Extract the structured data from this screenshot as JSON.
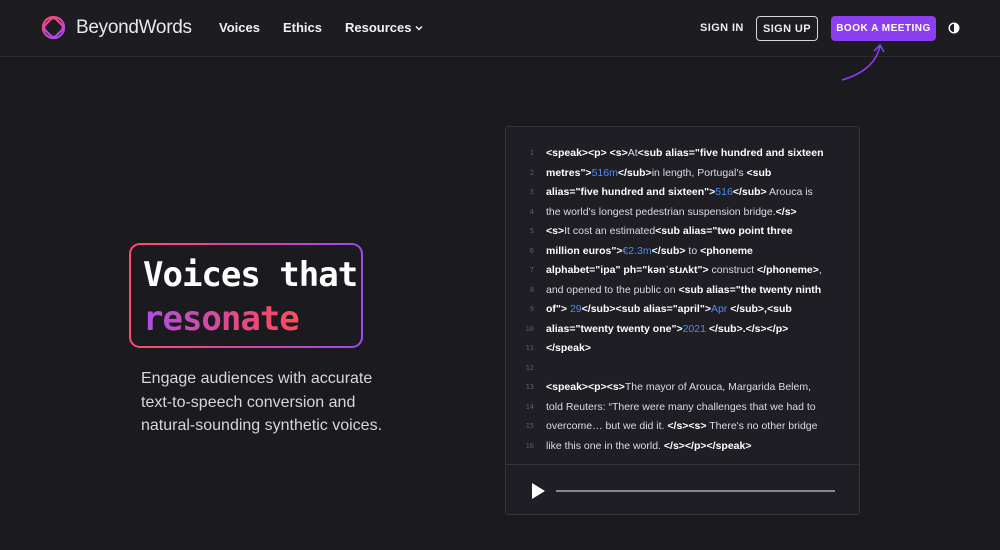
{
  "brand": {
    "name": "BeyondWords",
    "accent": "#8b3ff0"
  },
  "nav": {
    "items": [
      {
        "label": "Voices"
      },
      {
        "label": "Ethics"
      },
      {
        "label": "Resources",
        "icon": "chevron-down-icon"
      }
    ],
    "sign_in": "SIGN IN",
    "sign_up": "SIGN UP",
    "book_meeting": "BOOK A MEETING",
    "theme_icon": "contrast-icon"
  },
  "hero": {
    "headline_line1": "Voices that",
    "headline_line2": "resonate",
    "subtext": "Engage audiences with accurate text-to-speech conversion and natural-sounding synthetic voices."
  },
  "code": {
    "lines": [
      {
        "n": "1",
        "segs": [
          [
            "t",
            "<speak><p> <s>"
          ],
          [
            "p",
            "At"
          ],
          [
            "t",
            "<sub alias=\"five hundred and sixteen"
          ]
        ]
      },
      {
        "n": "2",
        "segs": [
          [
            "t",
            "metres\">"
          ],
          [
            "n",
            "516m"
          ],
          [
            "t",
            "</sub>"
          ],
          [
            "p",
            "in length, Portugal's "
          ],
          [
            "t",
            "<sub"
          ]
        ]
      },
      {
        "n": "3",
        "segs": [
          [
            "t",
            "alias=\"five hundred and sixteen\">"
          ],
          [
            "n",
            "516"
          ],
          [
            "t",
            "</sub>"
          ],
          [
            "p",
            " Arouca is"
          ]
        ]
      },
      {
        "n": "4",
        "segs": [
          [
            "p",
            "the world's longest pedestrian suspension bridge."
          ],
          [
            "t",
            "</s>"
          ]
        ]
      },
      {
        "n": "5",
        "segs": [
          [
            "t",
            "<s>"
          ],
          [
            "p",
            "It cost an estimated"
          ],
          [
            "t",
            "<sub alias=\"two point three"
          ]
        ]
      },
      {
        "n": "6",
        "segs": [
          [
            "t",
            "million euros\">"
          ],
          [
            "n",
            "€2.3m"
          ],
          [
            "t",
            "</sub>"
          ],
          [
            "p",
            " to "
          ],
          [
            "t",
            "<phoneme"
          ]
        ]
      },
      {
        "n": "7",
        "segs": [
          [
            "t",
            "alphabet=\"ipa\" ph=\"kənˈstɹʌkt\">"
          ],
          [
            "p",
            " construct "
          ],
          [
            "t",
            "</phoneme>"
          ],
          [
            "p",
            ","
          ]
        ]
      },
      {
        "n": "8",
        "segs": [
          [
            "p",
            "and opened to the public on "
          ],
          [
            "t",
            "<sub alias=\"the twenty ninth"
          ]
        ]
      },
      {
        "n": "9",
        "segs": [
          [
            "t",
            "of\">"
          ],
          [
            "n",
            " 29"
          ],
          [
            "t",
            "</sub><sub alias=\"april\">"
          ],
          [
            "n",
            "Apr"
          ],
          [
            "t",
            " </sub>,<sub"
          ]
        ]
      },
      {
        "n": "10",
        "segs": [
          [
            "t",
            "alias=\"twenty twenty one\">"
          ],
          [
            "n",
            "2021"
          ],
          [
            "t",
            " </sub>.</s></p>"
          ]
        ]
      },
      {
        "n": "11",
        "segs": [
          [
            "t",
            "</speak>"
          ]
        ]
      },
      {
        "n": "12",
        "segs": []
      },
      {
        "n": "13",
        "segs": [
          [
            "t",
            "<speak><p><s>"
          ],
          [
            "p",
            "The mayor of Arouca, Margarida Belem,"
          ]
        ]
      },
      {
        "n": "14",
        "segs": [
          [
            "p",
            "told Reuters: “There were many challenges that we had to"
          ]
        ]
      },
      {
        "n": "15",
        "segs": [
          [
            "p",
            "overcome… but we did it. "
          ],
          [
            "t",
            "</s><s>"
          ],
          [
            "p",
            " There's no other bridge"
          ]
        ]
      },
      {
        "n": "16",
        "segs": [
          [
            "p",
            "like this one in the world. "
          ],
          [
            "t",
            "</s></p></speak>"
          ]
        ]
      }
    ]
  },
  "player": {
    "play_icon": "play-icon"
  }
}
